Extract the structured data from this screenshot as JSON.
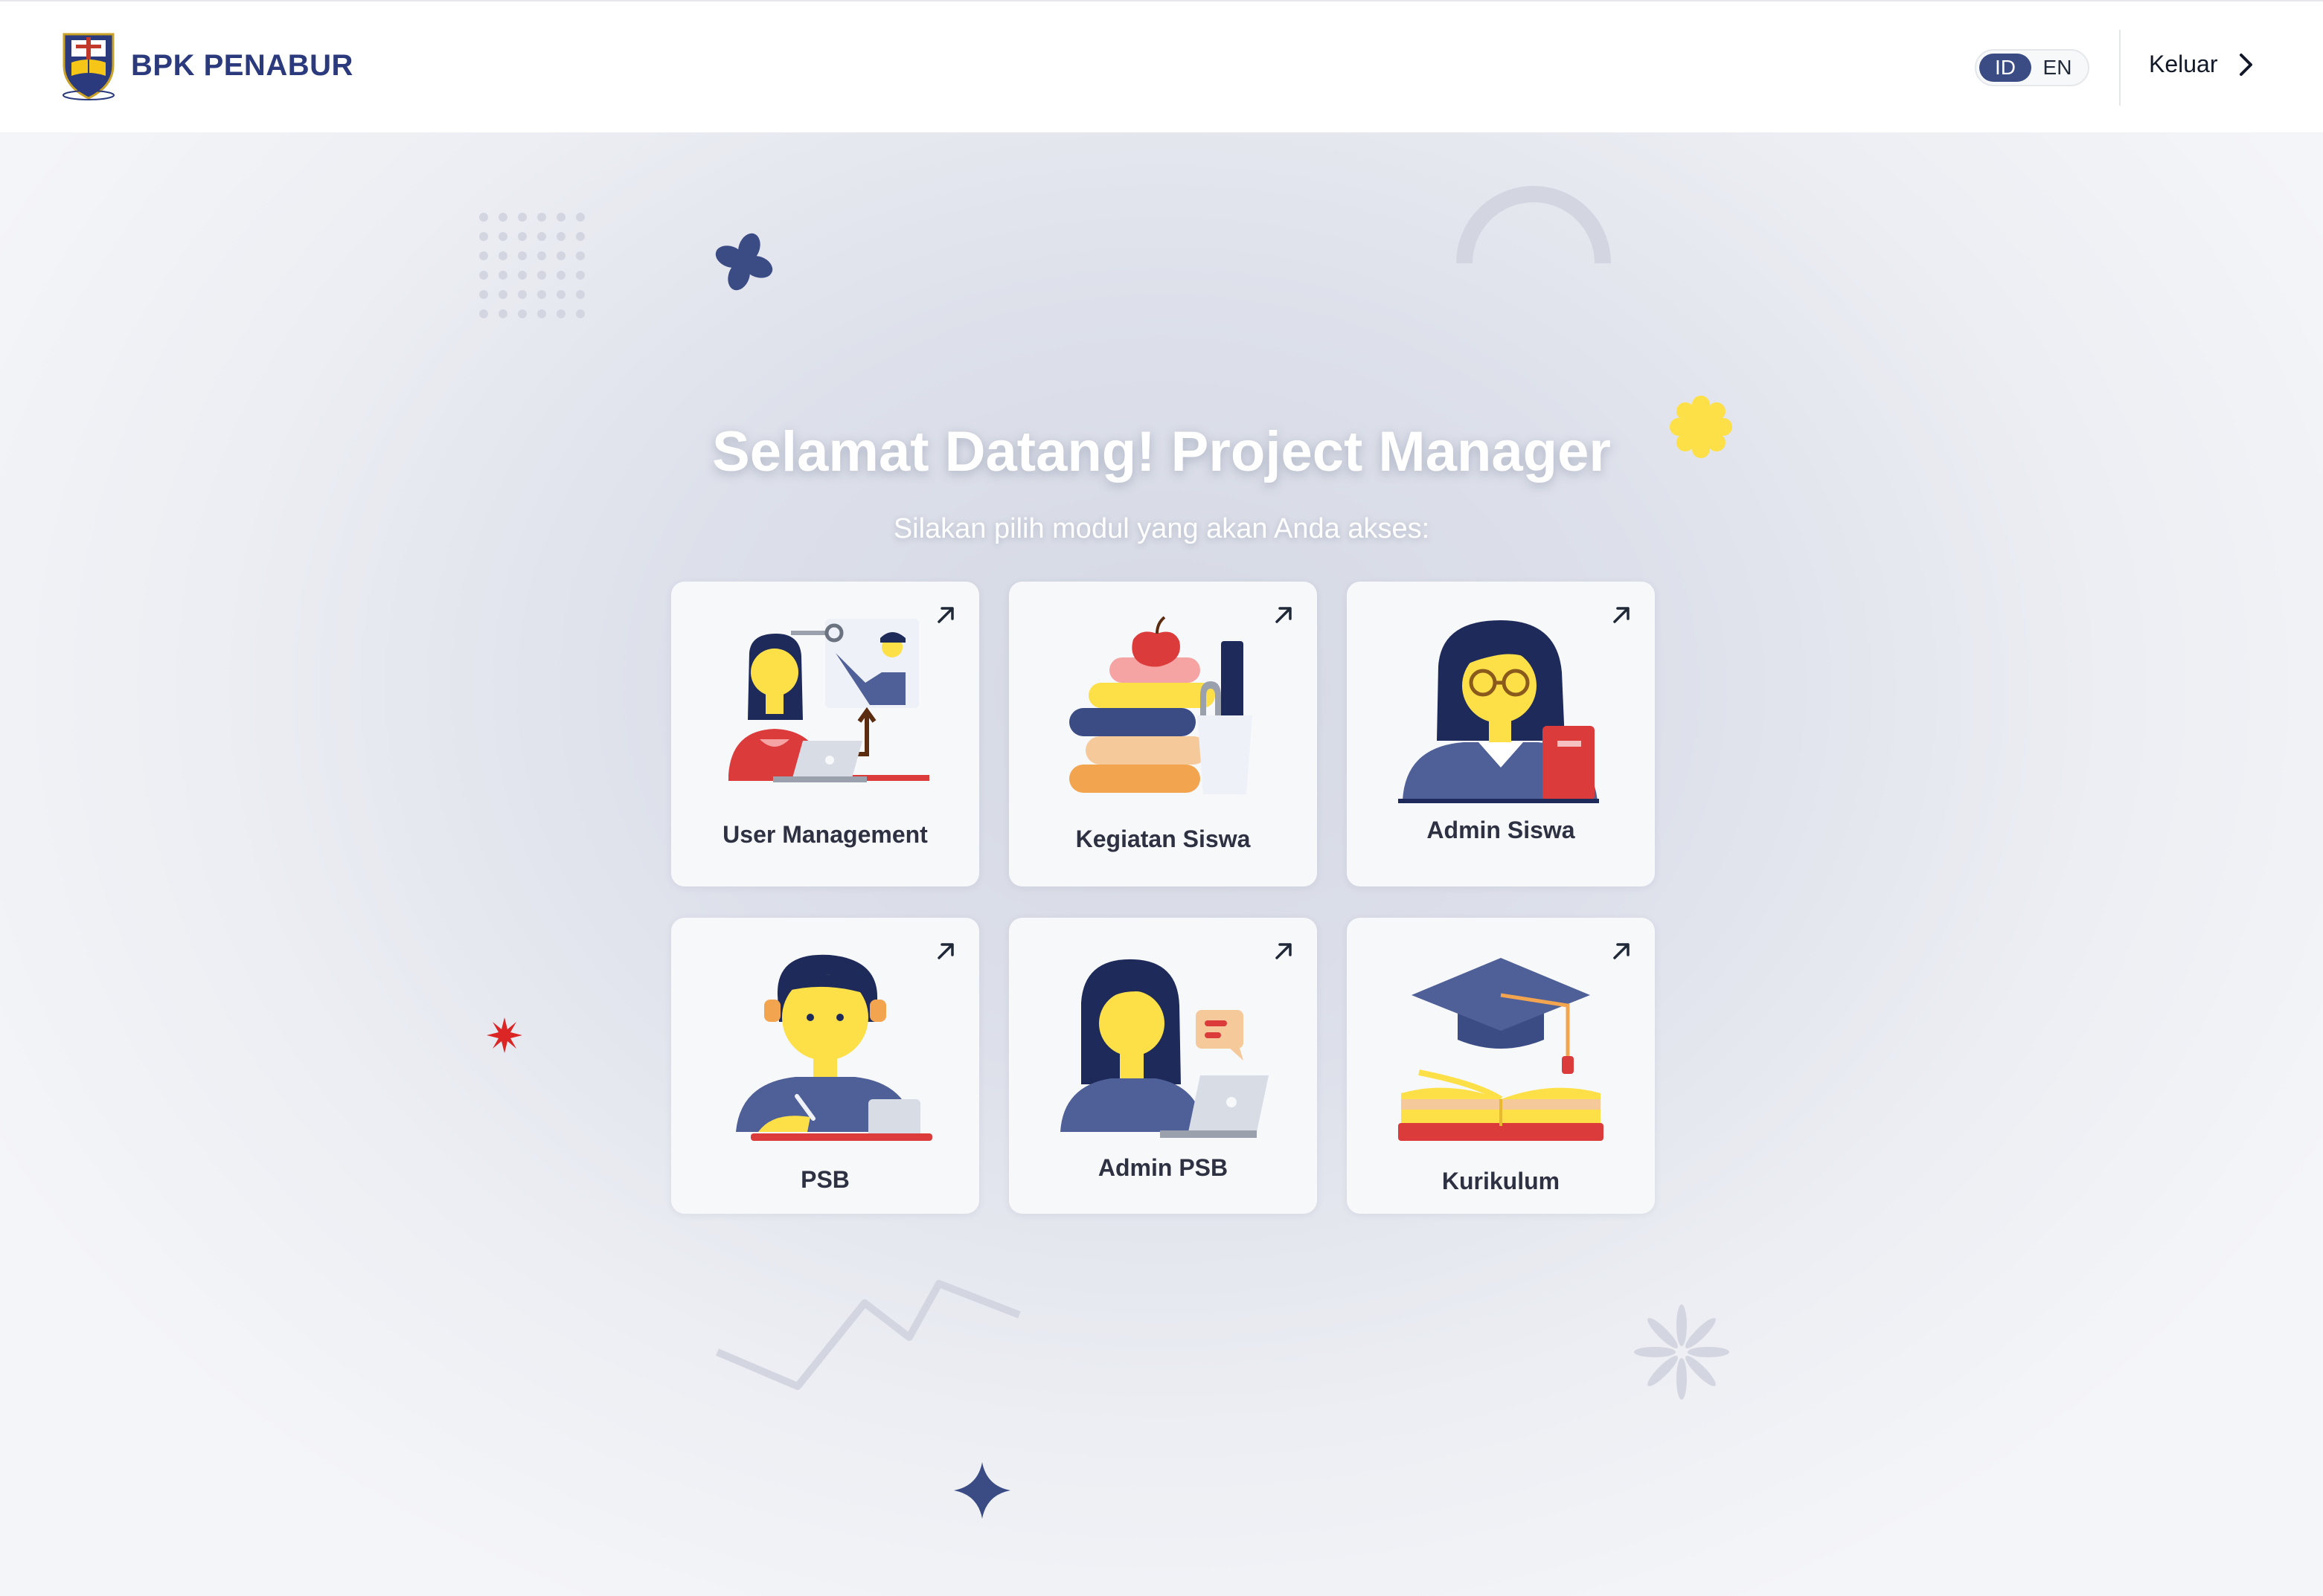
{
  "header": {
    "brand": "BPK PENABUR",
    "languages": [
      {
        "code": "ID",
        "active": true
      },
      {
        "code": "EN",
        "active": false
      }
    ],
    "logout_label": "Keluar"
  },
  "main": {
    "welcome_title": "Selamat Datang! Project Manager",
    "subtitle": "Silakan pilih modul yang akan Anda akses:",
    "modules": [
      {
        "label": "User Management",
        "icon": "user-management-illustration"
      },
      {
        "label": "Kegiatan Siswa",
        "icon": "books-apple-illustration"
      },
      {
        "label": "Admin Siswa",
        "icon": "teacher-glasses-illustration"
      },
      {
        "label": "PSB",
        "icon": "student-writing-illustration"
      },
      {
        "label": "Admin PSB",
        "icon": "admin-laptop-illustration"
      },
      {
        "label": "Kurikulum",
        "icon": "graduation-cap-book-illustration"
      }
    ]
  },
  "colors": {
    "brand_navy": "#2a3a7c",
    "toggle_active": "#3b4c85",
    "accent_yellow": "#fde047",
    "accent_red": "#dc2626"
  }
}
